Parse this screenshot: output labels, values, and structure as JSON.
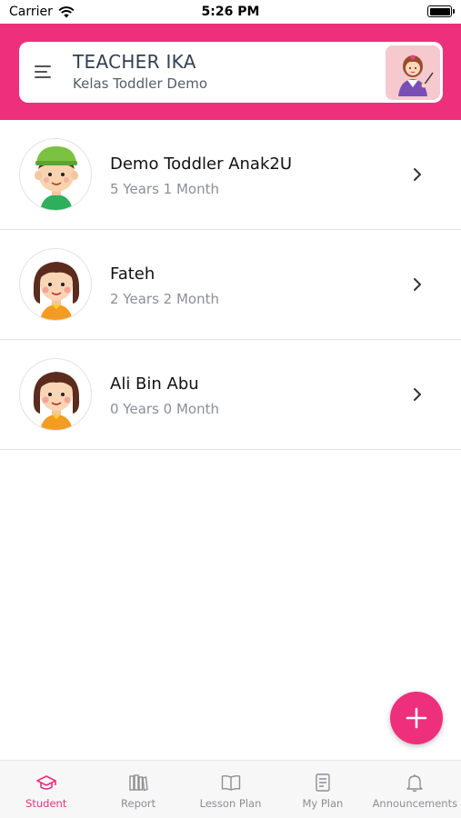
{
  "status_bar": {
    "carrier": "Carrier",
    "time": "5:26 PM"
  },
  "header": {
    "teacher_name": "TEACHER IKA",
    "class_name": "Kelas Toddler Demo"
  },
  "students": [
    {
      "name": "Demo Toddler Anak2U",
      "age": "5 Years 1 Month",
      "avatar": "boy-cap-avatar"
    },
    {
      "name": "Fateh",
      "age": "2 Years 2 Month",
      "avatar": "girl-avatar"
    },
    {
      "name": "Ali Bin Abu",
      "age": "0 Years 0 Month",
      "avatar": "girl-avatar"
    }
  ],
  "fab": {
    "icon": "plus-icon"
  },
  "tabs": [
    {
      "label": "Student",
      "icon": "graduation-cap-icon",
      "active": true
    },
    {
      "label": "Report",
      "icon": "books-icon",
      "active": false
    },
    {
      "label": "Lesson Plan",
      "icon": "open-book-icon",
      "active": false
    },
    {
      "label": "My Plan",
      "icon": "document-icon",
      "active": false
    },
    {
      "label": "Announcements",
      "icon": "bell-icon",
      "active": false
    }
  ],
  "colors": {
    "accent": "#ee2f7c",
    "text_dark": "#33404f",
    "text_muted": "#8a8f96",
    "tab_inactive": "#8e8e93"
  }
}
